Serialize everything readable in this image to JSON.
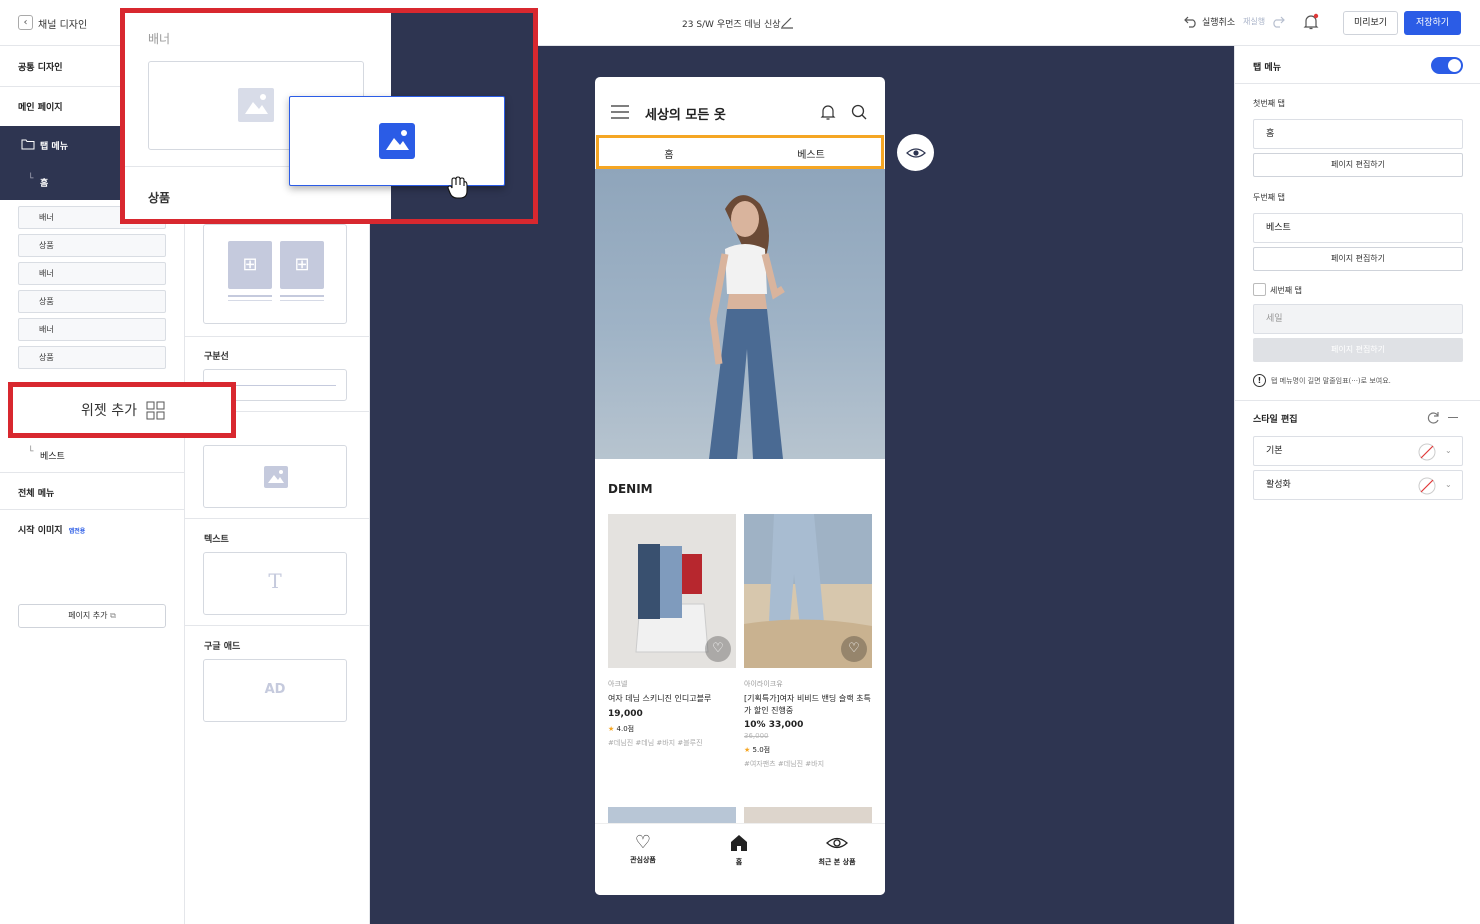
{
  "topbar": {
    "back_label": "채널 디자인",
    "doc_title": "23 S/W 우먼즈 데님 신상",
    "undo_label": "실행취소",
    "redo_label": "재실행",
    "preview_label": "미리보기",
    "save_label": "저장하기"
  },
  "left_nav": {
    "common_design": "공통 디자인",
    "main_page": "메인 페이지",
    "tab_menu": "탭 메뉴",
    "home": "홈",
    "widgets": [
      "배너",
      "상품",
      "배너",
      "상품",
      "배너",
      "상품"
    ],
    "best": "베스트",
    "all_menu": "전체 메뉴",
    "start_image": "시작 이미지",
    "start_image_badge": "앱전용",
    "add_page": "페이지 추가"
  },
  "widget_popup": {
    "banner_title": "배너",
    "product_title": "상품"
  },
  "add_widget_callout": "위젯 추가",
  "widgets_panel": {
    "divider_label": "구분선",
    "text_label": "텍스트",
    "text_glyph": "T",
    "google_ad_label": "구글 애드",
    "ad_glyph": "AD"
  },
  "phone": {
    "title": "세상의 모든 옷",
    "tabs": [
      "홈",
      "베스트"
    ],
    "section_title": "DENIM",
    "products": [
      {
        "brand": "아크넬",
        "name": "여자 데님 스키니진 인디고블루",
        "price": "19,000",
        "discount": "",
        "original_price": "",
        "rating": "4.0점",
        "tags": "#데님진 #데님 #바지 #블루진"
      },
      {
        "brand": "아이라이크유",
        "name": "[기획특가]여자 비비드 밴딩 슬랙 초특가 할인 진행중",
        "price": "33,000",
        "discount": "10%",
        "original_price": "36,000",
        "rating": "5.0점",
        "tags": "#여자팬츠 #데님진 #바지"
      }
    ],
    "bottom_nav": [
      "관심상품",
      "홈",
      "최근 본 상품"
    ]
  },
  "right_panel": {
    "tab_menu_label": "탭 메뉴",
    "tab_menu_enabled": true,
    "first_tab_label": "첫번째 탭",
    "first_tab_value": "홈",
    "edit_page_label": "페이지 편집하기",
    "second_tab_label": "두번째 탭",
    "second_tab_value": "베스트",
    "third_tab_label": "세번째 탭",
    "third_tab_placeholder": "세일",
    "info_text": "탭 메뉴명이 길면 말줄임표(···)로 보여요.",
    "style_edit_label": "스타일 편집",
    "style_default": "기본",
    "style_active": "활성화"
  },
  "colors": {
    "accent": "#2b5ce6",
    "canvas": "#2e3551",
    "highlight": "#f5a623",
    "callout": "#d8282f"
  }
}
